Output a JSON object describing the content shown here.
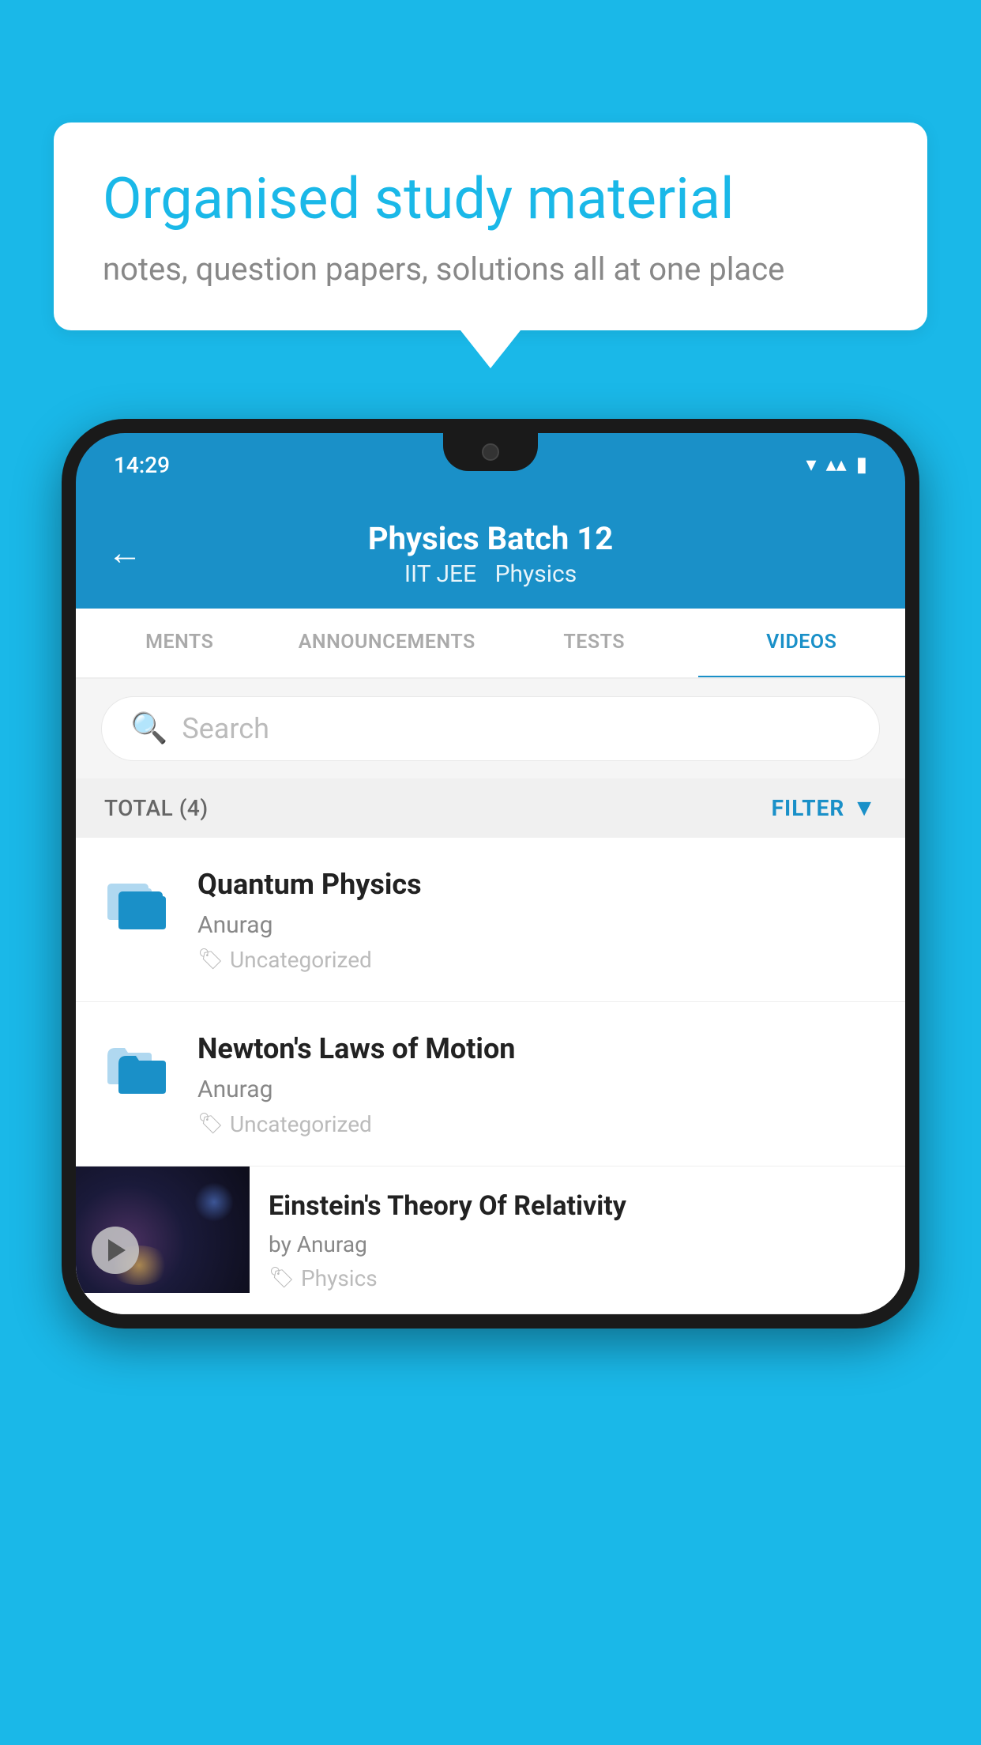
{
  "background_color": "#1ab8e8",
  "speech_bubble": {
    "title": "Organised study material",
    "subtitle": "notes, question papers, solutions all at one place"
  },
  "phone": {
    "status_bar": {
      "time": "14:29"
    },
    "header": {
      "title": "Physics Batch 12",
      "subtitle1": "IIT JEE",
      "subtitle2": "Physics",
      "back_label": "←"
    },
    "tabs": [
      {
        "label": "MENTS",
        "active": false
      },
      {
        "label": "ANNOUNCEMENTS",
        "active": false
      },
      {
        "label": "TESTS",
        "active": false
      },
      {
        "label": "VIDEOS",
        "active": true
      }
    ],
    "search": {
      "placeholder": "Search"
    },
    "filter_bar": {
      "total_label": "TOTAL (4)",
      "filter_label": "FILTER"
    },
    "videos": [
      {
        "title": "Quantum Physics",
        "author": "Anurag",
        "tag": "Uncategorized",
        "has_thumbnail": false
      },
      {
        "title": "Newton's Laws of Motion",
        "author": "Anurag",
        "tag": "Uncategorized",
        "has_thumbnail": false
      },
      {
        "title": "Einstein's Theory Of Relativity",
        "author": "by Anurag",
        "tag": "Physics",
        "has_thumbnail": true
      }
    ]
  }
}
